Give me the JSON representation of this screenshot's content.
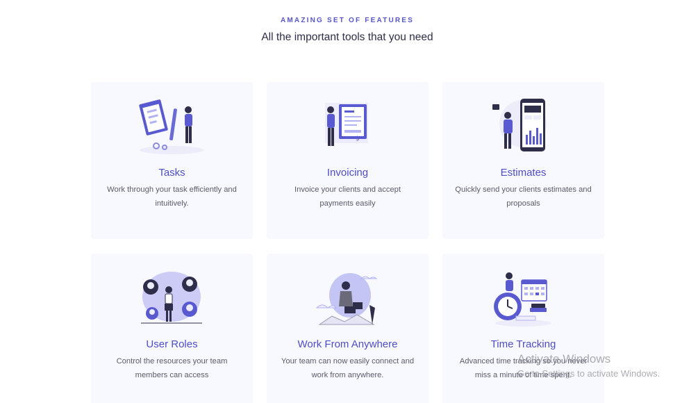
{
  "section": {
    "eyebrow": "AMAZING SET OF FEATURES",
    "heading": "All the important tools that you need"
  },
  "features": [
    {
      "title": "Tasks",
      "description": "Work through your task efficiently and intuitively.",
      "illustration": "tasks-clipboard-illustration"
    },
    {
      "title": "Invoicing",
      "description": "Invoice your clients and accept payments easily",
      "illustration": "invoice-illustration"
    },
    {
      "title": "Estimates",
      "description": "Quickly send your clients estimates and proposals",
      "illustration": "estimates-phone-illustration"
    },
    {
      "title": "User Roles",
      "description": "Control the resources your team members can access",
      "illustration": "user-roles-illustration"
    },
    {
      "title": "Work From Anywhere",
      "description": "Your team can now easily connect and work from anywhere.",
      "illustration": "remote-work-illustration"
    },
    {
      "title": "Time Tracking",
      "description": "Advanced time tracking so you never miss a minute of time spent.",
      "illustration": "time-tracking-illustration"
    }
  ],
  "colors": {
    "accent": "#4e4ec4",
    "card_background": "#f8f8ff",
    "illustration_lavender": "#b3b3f2",
    "text_muted": "#5b5b6b"
  },
  "overlay": {
    "watermark_line1": "Activate Windows",
    "watermark_line2": "Go to Settings to activate Windows."
  }
}
